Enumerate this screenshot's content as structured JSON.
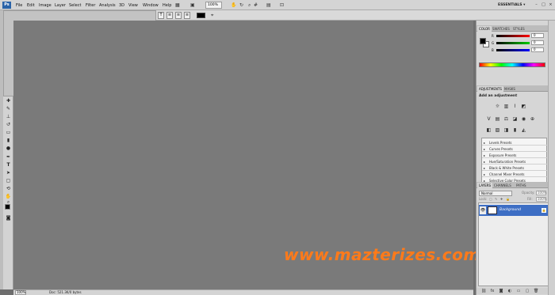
{
  "menubar": {
    "app_logo": "Ps",
    "items": [
      "File",
      "Edit",
      "Image",
      "Layer",
      "Select",
      "Filter",
      "Analysis",
      "3D",
      "View",
      "Window",
      "Help"
    ],
    "zoom": "100%",
    "workspace": "ESSENTIALS"
  },
  "options": {
    "type_toggle": "T"
  },
  "canvas": {
    "watermark": "www.mazterizes.com"
  },
  "status": {
    "zoom": "100%",
    "doc": "Doc: 521.3K/0 bytes"
  },
  "color_panel": {
    "tabs": [
      "COLOR",
      "SWATCHES",
      "STYLES"
    ],
    "sliders": [
      {
        "label": "R",
        "value": "0",
        "color": "#ff0000"
      },
      {
        "label": "G",
        "value": "0",
        "color": "#00cc00"
      },
      {
        "label": "B",
        "value": "0",
        "color": "#0000ff"
      }
    ]
  },
  "adjustments_panel": {
    "tabs": [
      "ADJUSTMENTS",
      "MASKS"
    ],
    "title": "Add an adjustment",
    "presets": [
      "Levels Presets",
      "Curves Presets",
      "Exposure Presets",
      "Hue/Saturation Presets",
      "Black & White Presets",
      "Channel Mixer Presets",
      "Selective Color Presets"
    ]
  },
  "layers_panel": {
    "tabs": [
      "LAYERS",
      "CHANNELS",
      "PATHS"
    ],
    "blend_mode": "Normal",
    "opacity_label": "Opacity:",
    "opacity": "100%",
    "lock_label": "Lock:",
    "fill_label": "Fill:",
    "fill": "100%",
    "layer_name": "Background"
  }
}
